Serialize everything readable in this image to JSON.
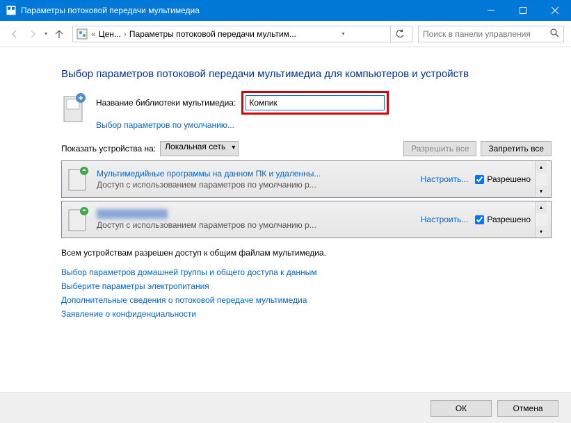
{
  "window": {
    "title": "Параметры потоковой передачи мультимедиа"
  },
  "breadcrumb": {
    "part1": "Цен...",
    "part2": "Параметры потоковой передачи мультим..."
  },
  "search": {
    "placeholder": "Поиск в панели управления"
  },
  "heading": "Выбор параметров потоковой передачи мультимедиа для компьютеров и устройств",
  "lib": {
    "label": "Название библиотеки мультимедиа:",
    "value": "Компик",
    "defaults_link": "Выбор параметров по умолчанию..."
  },
  "show": {
    "label": "Показать устройства на:",
    "value": "Локальная сеть",
    "allow_all": "Разрешить все",
    "block_all": "Запретить все"
  },
  "devices": [
    {
      "title": "Мультимедийные программы на данном ПК и удаленны...",
      "subtitle": "Доступ с использованием параметров по умолчанию р...",
      "configure": "Настроить...",
      "allowed_label": "Разрешено",
      "allowed": true,
      "blur": false
    },
    {
      "title": "████████████",
      "subtitle": "Доступ с использованием параметров по умолчанию р...",
      "configure": "Настроить...",
      "allowed_label": "Разрешено",
      "allowed": true,
      "blur": true
    }
  ],
  "status": "Всем устройствам разрешен доступ к общим файлам мультимедиа.",
  "links": [
    "Выбор параметров домашней группы и общего доступа к данным",
    "Выберите параметры электропитания",
    "Дополнительные сведения о потоковой передаче мультимедиа",
    "Заявление о конфиденциальности"
  ],
  "footer": {
    "ok": "ОК",
    "cancel": "Отмена"
  }
}
